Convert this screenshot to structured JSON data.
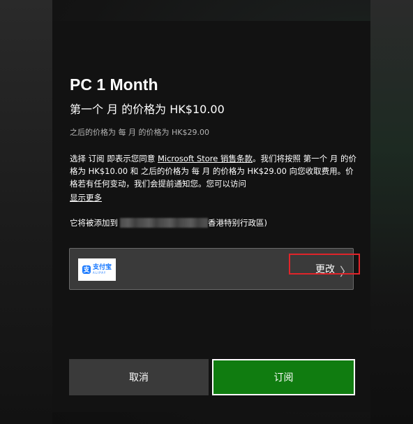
{
  "dialog": {
    "title": "PC 1 Month",
    "subtitle": "第一个 月 的价格为 HK$10.00",
    "after_price": "之后的价格为 每 月 的价格为 HK$29.00",
    "terms_prefix": "选择 订阅 即表示您同意 ",
    "terms_link": "Microsoft Store 销售条款",
    "terms_suffix": "。我们将按照 第一个 月 的价格为 HK$10.00 和 之后的价格为 每 月 的价格为 HK$29.00 向您收取费用。价格若有任何变动，我们会提前通知您。您可以访问",
    "show_more": "显示更多",
    "added_prefix": "它将被添加到",
    "added_suffix": "香港特别行政區)"
  },
  "payment": {
    "method_logo_cn": "支付宝",
    "method_logo_en": "ALIPAY",
    "method_logo_mark": "支",
    "change_label": "更改",
    "chevron": "〉"
  },
  "buttons": {
    "cancel_label": "取消",
    "subscribe_label": "订阅"
  },
  "colors": {
    "accent_green": "#107c10",
    "alipay_blue": "#1677ff",
    "highlight_red": "#e0242a"
  },
  "icons": {
    "payment_logo": "alipay-logo-icon",
    "change_chevron": "chevron-right-icon"
  }
}
